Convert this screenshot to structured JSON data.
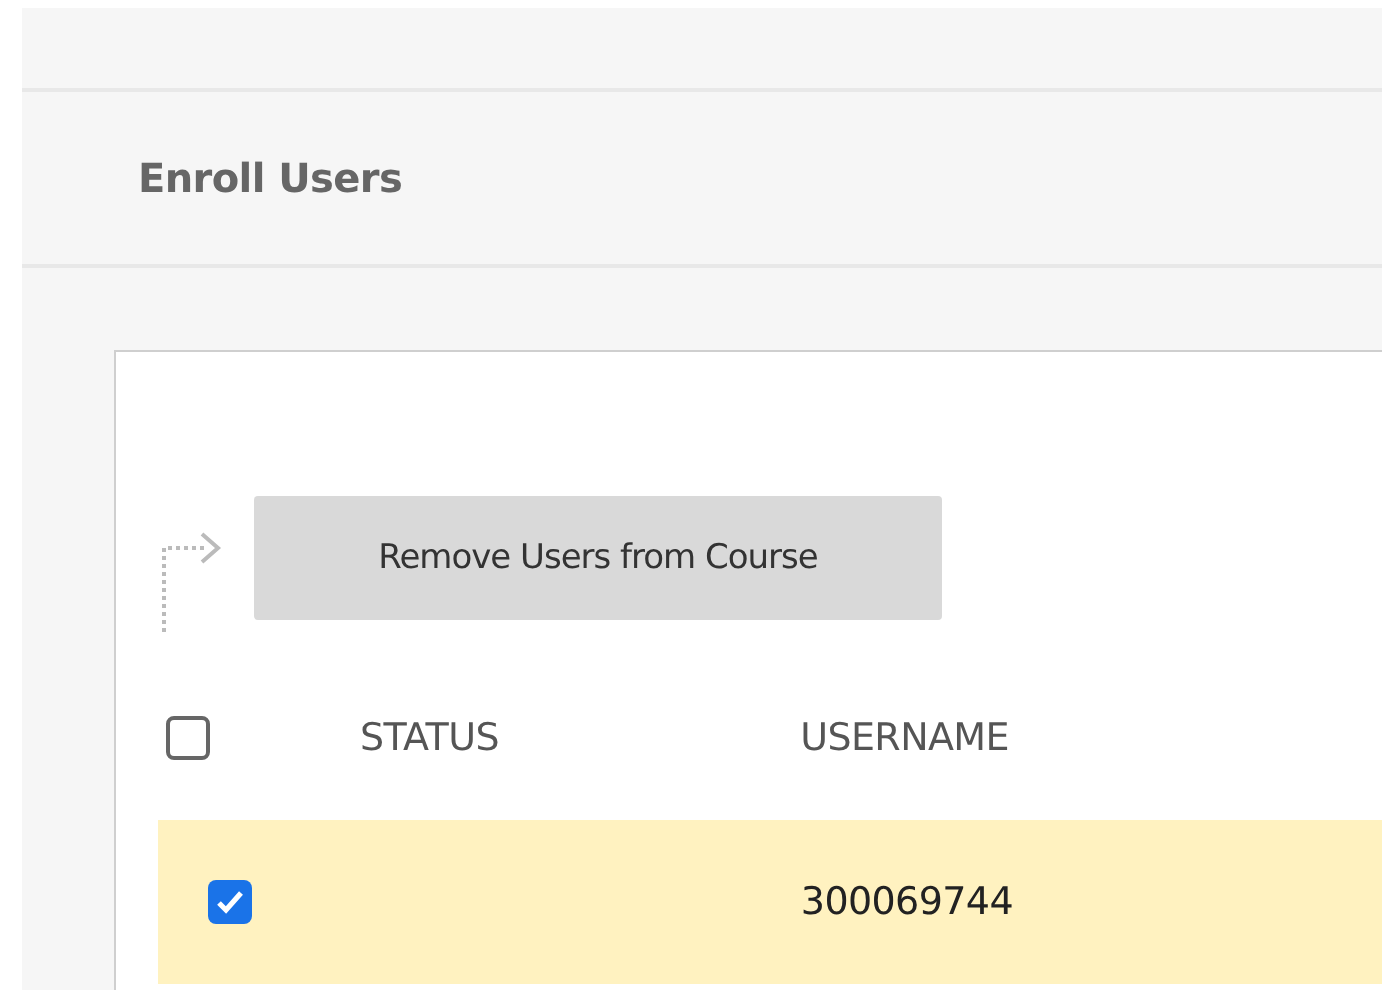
{
  "page": {
    "title": "Enroll Users"
  },
  "action_button": {
    "label": "Remove Users from Course"
  },
  "table": {
    "select_all": {
      "checked": false
    },
    "columns": [
      "STATUS",
      "USERNAME"
    ],
    "rows": [
      {
        "selected": true,
        "checked": true,
        "cells": [
          "",
          "300069744"
        ]
      }
    ]
  }
}
